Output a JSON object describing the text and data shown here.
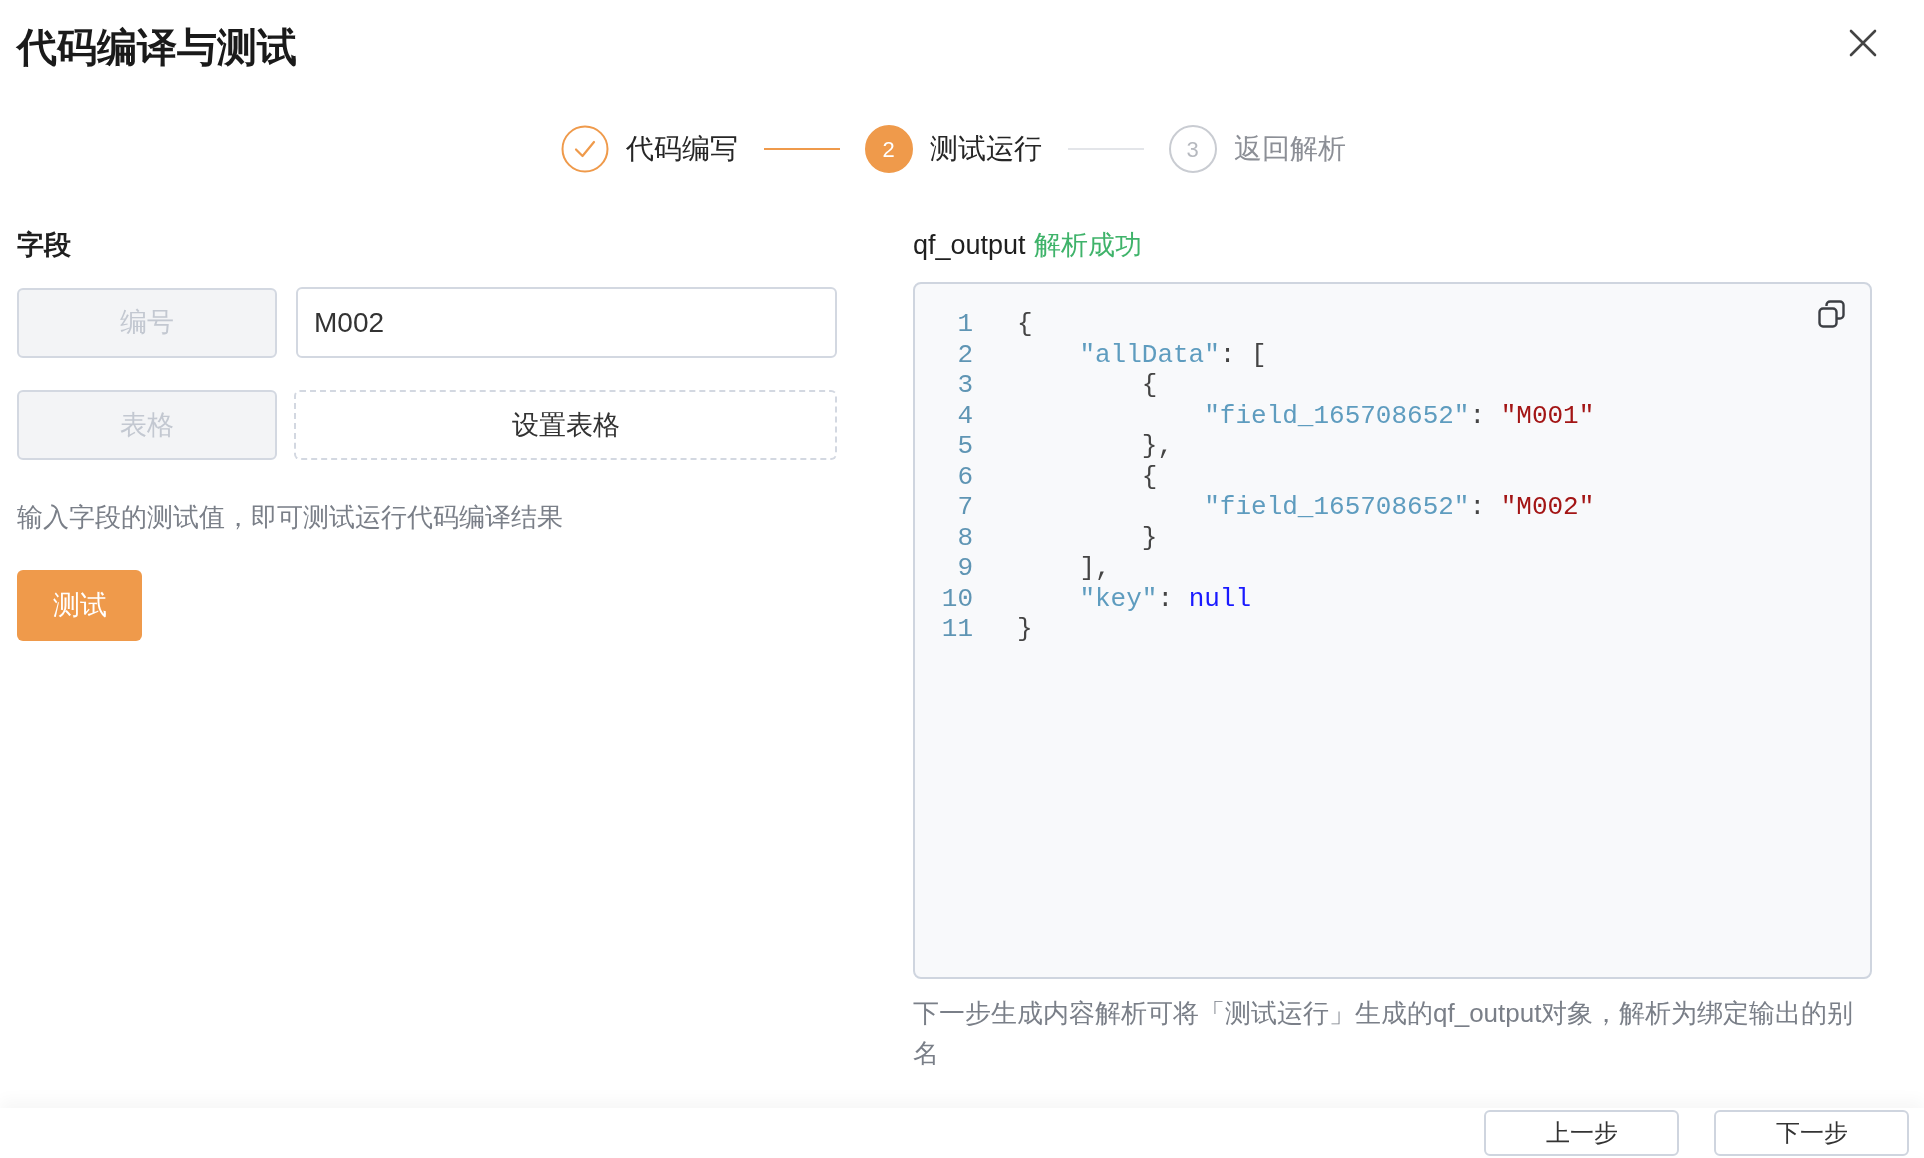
{
  "dialog": {
    "title": "代码编译与测试"
  },
  "steps": [
    {
      "label": "代码编写",
      "done": true,
      "selected": false
    },
    {
      "number": "2",
      "label": "测试运行",
      "done": false,
      "selected": true
    },
    {
      "number": "3",
      "label": "返回解析",
      "done": false,
      "selected": false
    }
  ],
  "fields": {
    "heading": "字段",
    "rows": [
      {
        "kind": "input",
        "name": "编号",
        "disabled": true,
        "value": "M002"
      },
      {
        "kind": "table",
        "name": "表格",
        "disabled": true,
        "action": "设置表格"
      }
    ],
    "hint": "输入字段的测试值，即可测试运行代码编译结果",
    "test_button": "测试"
  },
  "output": {
    "variable": "qf_output",
    "result": {
      "text": "解析成功",
      "kind": "success"
    },
    "code_lines": [
      {
        "number": "1",
        "tokens": [
          {
            "kind": "punct",
            "text": "{"
          }
        ]
      },
      {
        "number": "2",
        "tokens": [
          {
            "kind": "key",
            "text": "    \"allData\""
          },
          {
            "kind": "punct",
            "text": ": ["
          }
        ]
      },
      {
        "number": "3",
        "tokens": [
          {
            "kind": "punct",
            "text": "        {"
          }
        ]
      },
      {
        "number": "4",
        "tokens": [
          {
            "kind": "key",
            "text": "            \"field_165708652\""
          },
          {
            "kind": "punct",
            "text": ": "
          },
          {
            "kind": "string",
            "text": "\"M001\""
          }
        ]
      },
      {
        "number": "5",
        "tokens": [
          {
            "kind": "punct",
            "text": "        },"
          }
        ]
      },
      {
        "number": "6",
        "tokens": [
          {
            "kind": "punct",
            "text": "        {"
          }
        ]
      },
      {
        "number": "7",
        "tokens": [
          {
            "kind": "key",
            "text": "            \"field_165708652\""
          },
          {
            "kind": "punct",
            "text": ": "
          },
          {
            "kind": "string",
            "text": "\"M002\""
          }
        ]
      },
      {
        "number": "8",
        "tokens": [
          {
            "kind": "punct",
            "text": "        }"
          }
        ]
      },
      {
        "number": "9",
        "tokens": [
          {
            "kind": "punct",
            "text": "    ],"
          }
        ]
      },
      {
        "number": "10",
        "tokens": [
          {
            "kind": "key",
            "text": "    \"key\""
          },
          {
            "kind": "punct",
            "text": ": "
          },
          {
            "kind": "null",
            "text": "null"
          }
        ]
      },
      {
        "number": "11",
        "tokens": [
          {
            "kind": "punct",
            "text": "}"
          }
        ]
      }
    ],
    "note": "下一步生成内容解析可将「测试运行」生成的qf_output对象，解析为绑定输出的别名"
  },
  "footer": {
    "buttons": [
      "上一步",
      "下一步"
    ]
  }
}
